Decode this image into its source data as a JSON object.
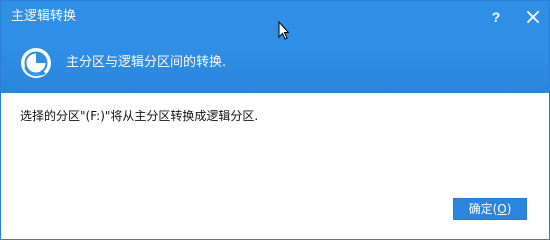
{
  "window": {
    "title": "主逻辑转换",
    "help_label": "?",
    "close_icon": "close-icon"
  },
  "header": {
    "icon": "partition-convert-icon",
    "subtitle": "主分区与逻辑分区间的转换."
  },
  "body": {
    "message": "选择的分区\"(F:)\"将从主分区转换成逻辑分区."
  },
  "footer": {
    "ok_label_prefix": "确定(",
    "ok_label_mnemonic": "O",
    "ok_label_suffix": ")"
  },
  "colors": {
    "header_blue": "#2f8ee6",
    "button_blue": "#2b84de",
    "text_dark": "#111111",
    "text_white": "#ffffff"
  }
}
